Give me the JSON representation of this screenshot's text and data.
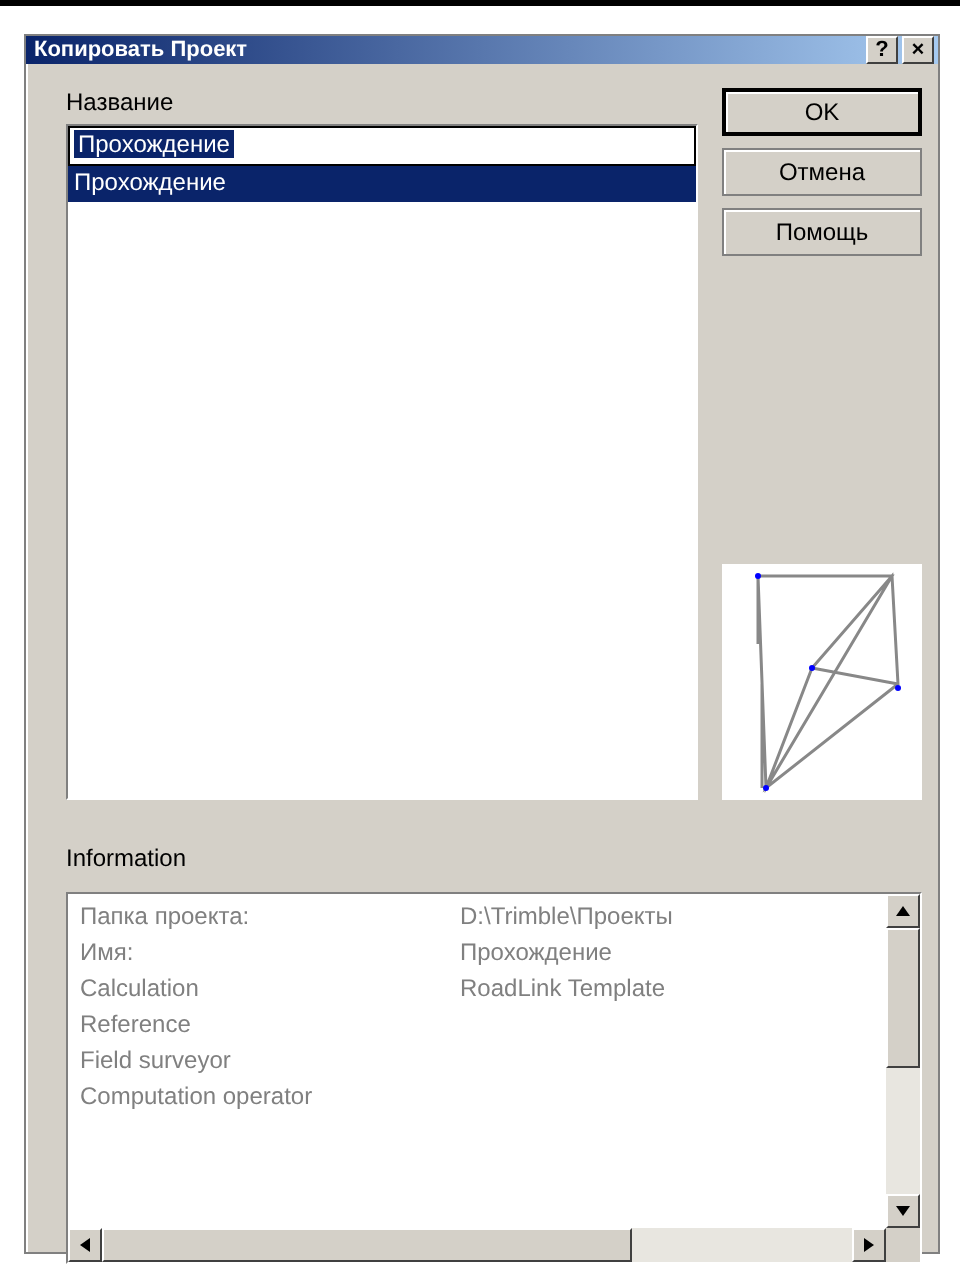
{
  "window": {
    "title": "Копировать Проект",
    "help": "?",
    "close": "×"
  },
  "name_label": "Название",
  "name_field": {
    "value": "Прохождение"
  },
  "projects": [
    {
      "label": "Прохождение",
      "selected": true
    }
  ],
  "buttons": [
    {
      "label": "OK",
      "default": true
    },
    {
      "label": "Отмена",
      "default": false
    },
    {
      "label": "Помощь",
      "default": false
    }
  ],
  "info_label": "Information",
  "info_rows": [
    {
      "label": "Папка проекта:",
      "value": "D:\\Trimble\\Проекты"
    },
    {
      "label": "Имя:",
      "value": "Прохождение"
    },
    {
      "label": "Calculation",
      "value": "RoadLink Template"
    },
    {
      "label": "Reference",
      "value": ""
    },
    {
      "label": "Field surveyor",
      "value": ""
    },
    {
      "label": "Computation operator",
      "value": ""
    }
  ]
}
